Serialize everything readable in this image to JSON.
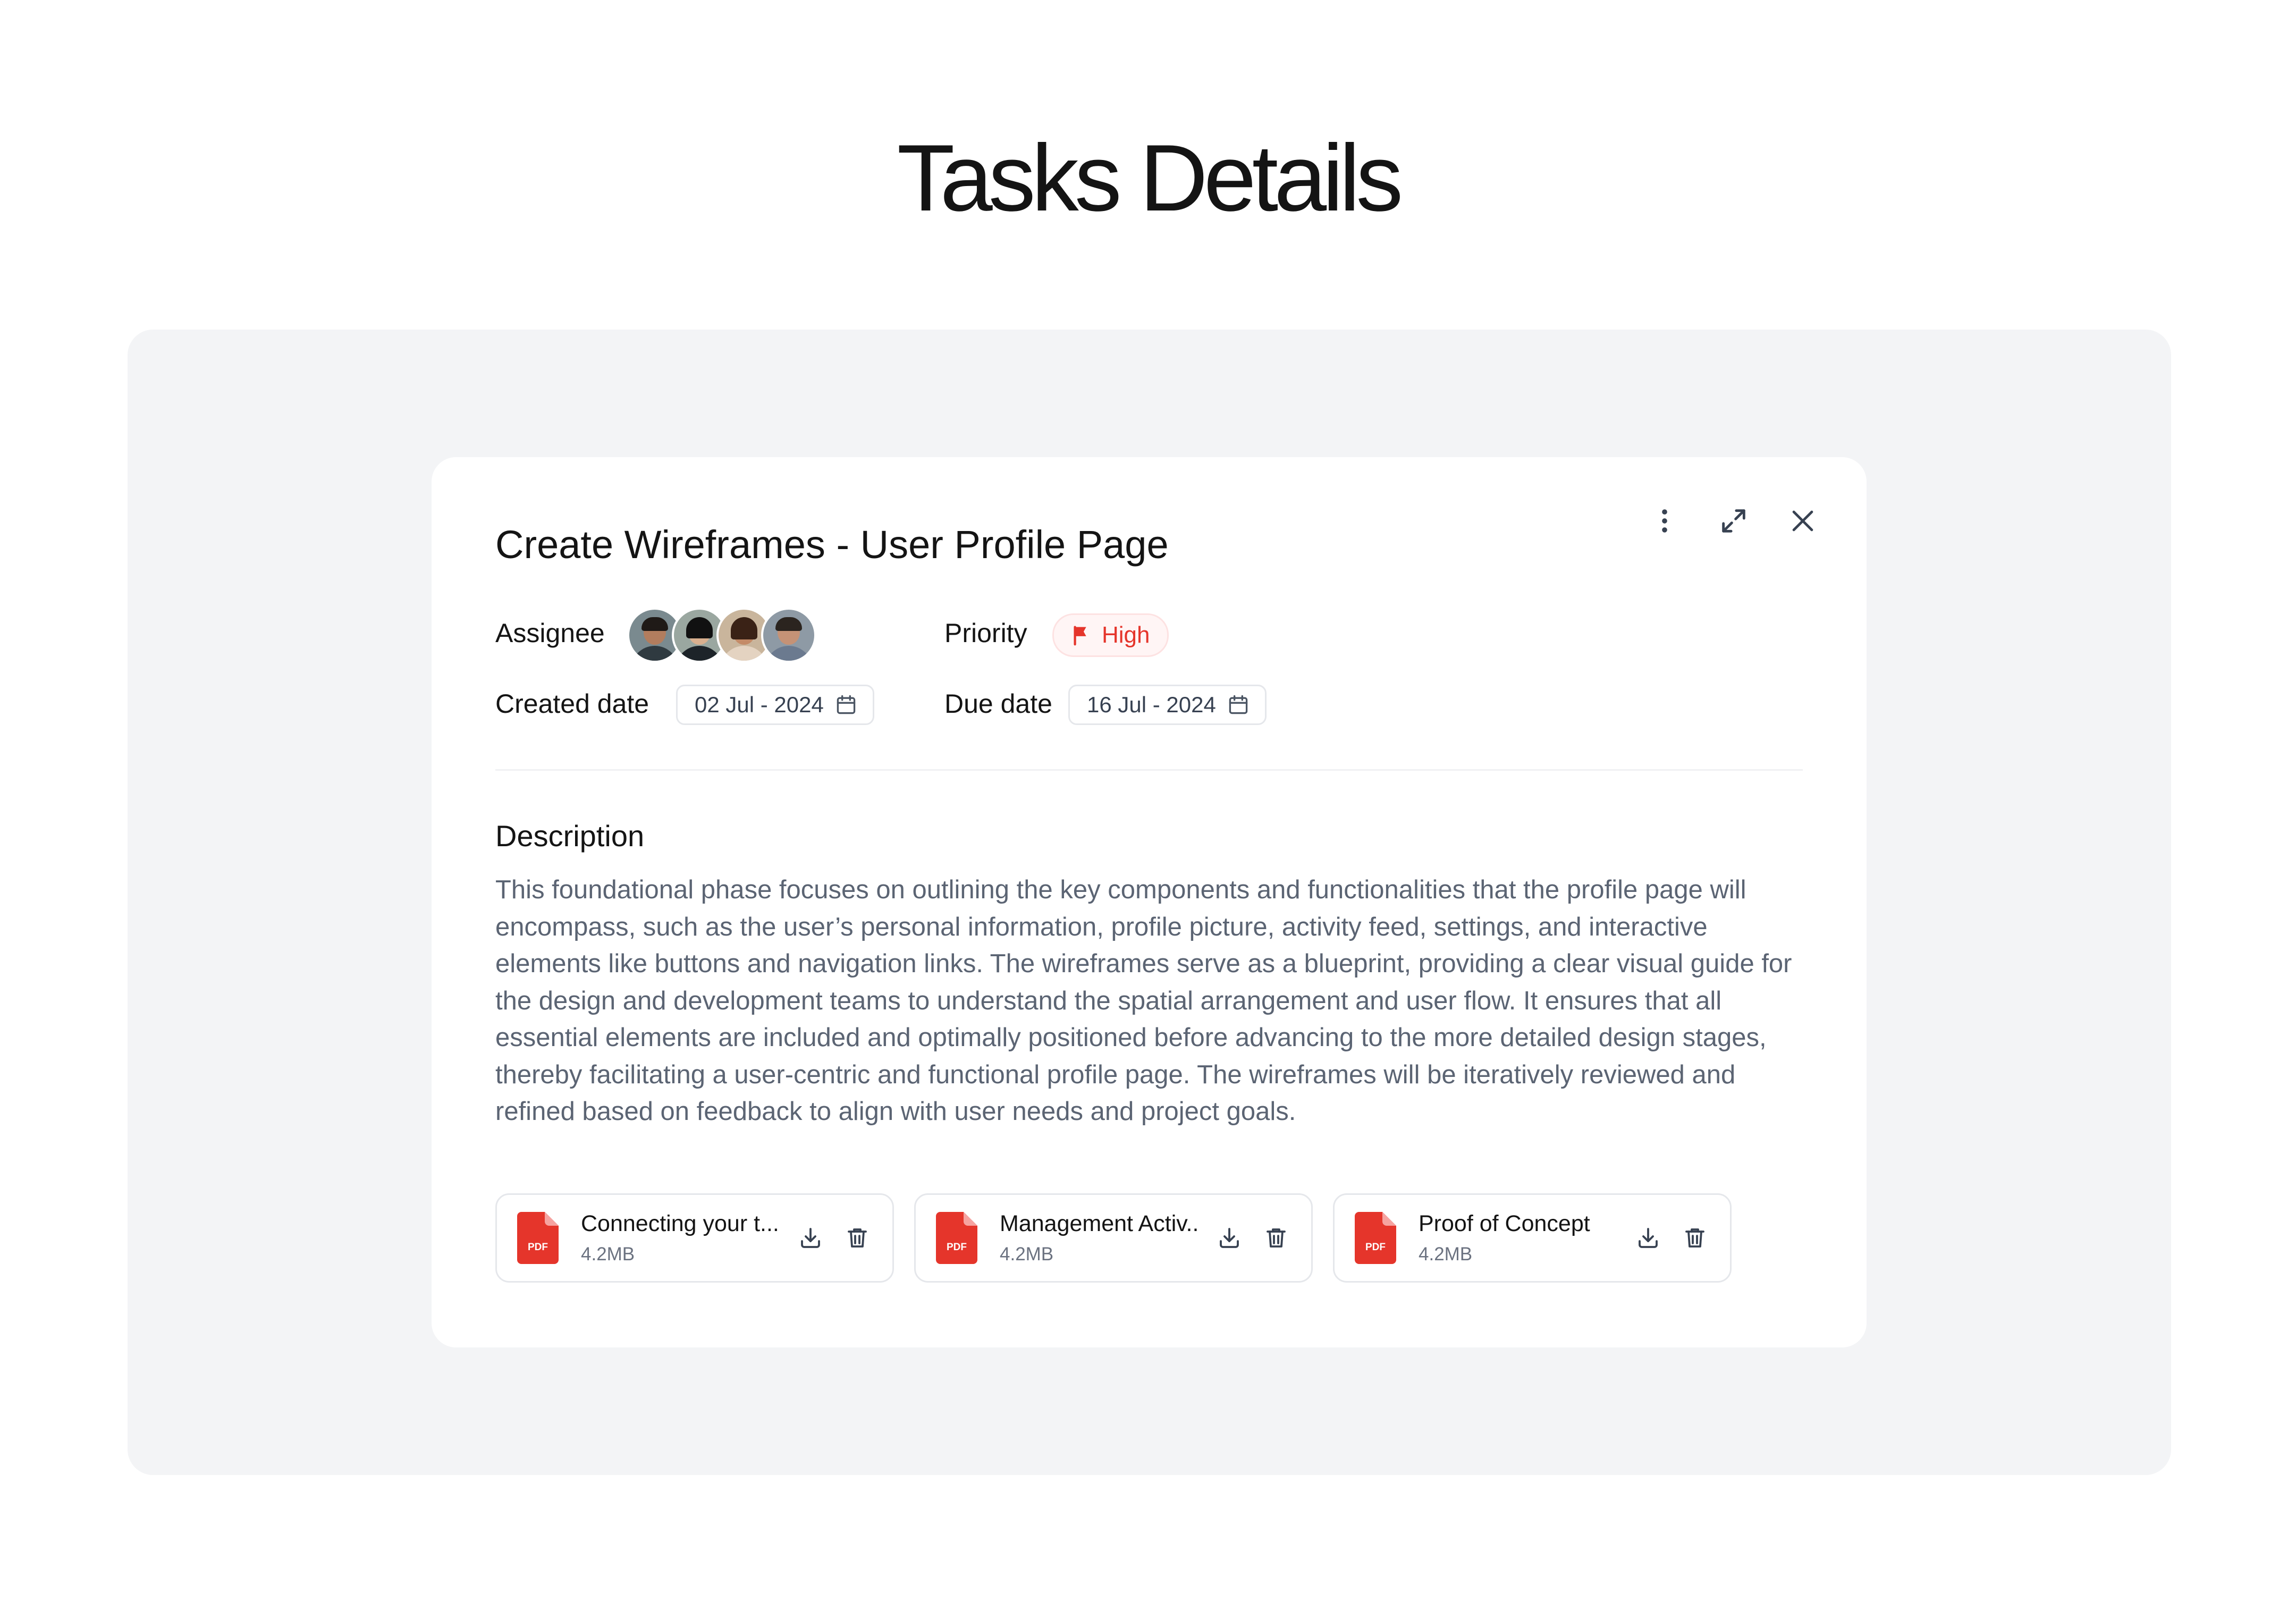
{
  "page": {
    "title": "Tasks Details"
  },
  "task": {
    "title": "Create Wireframes - User Profile Page",
    "assignee_label": "Assignee",
    "assignees": [
      {
        "name": "avatar-1"
      },
      {
        "name": "avatar-2"
      },
      {
        "name": "avatar-3"
      },
      {
        "name": "avatar-4"
      }
    ],
    "priority_label": "Priority",
    "priority_value": "High",
    "created_label": "Created date",
    "created_value": "02 Jul - 2024",
    "due_label": "Due date",
    "due_value": "16 Jul - 2024",
    "description_title": "Description",
    "description_lines": [
      "This foundational phase focuses on outlining the key components and functionalities that the profile page will",
      "encompass, such as the user’s personal information, profile picture, activity feed, settings, and interactive",
      "elements like buttons and navigation links. The wireframes serve as a blueprint, providing a clear visual guide for",
      "the design and development teams to understand the spatial arrangement and user flow. It ensures that all",
      "essential elements are included and optimally positioned before advancing to the more detailed design stages,",
      "thereby facilitating a user-centric and functional profile page. The wireframes will be iteratively reviewed and",
      "refined based on feedback to align with user needs and project goals."
    ]
  },
  "attachments": [
    {
      "name": "Connecting your t...",
      "size": "4.2MB",
      "type": "PDF"
    },
    {
      "name": "Management Activ...",
      "size": "4.2MB",
      "type": "PDF"
    },
    {
      "name": "Proof of Concept",
      "size": "4.2MB",
      "type": "PDF"
    }
  ],
  "icons": {
    "more": "more-vertical-icon",
    "expand": "expand-icon",
    "close": "close-icon",
    "flag": "flag-icon",
    "calendar": "calendar-icon",
    "pdf": "pdf-file-icon",
    "download": "download-icon",
    "delete": "trash-icon"
  },
  "colors": {
    "stage_background": "#f3f4f6",
    "priority_high": "#e5352b",
    "pdf_red": "#e5352b",
    "text_primary": "#141414",
    "text_secondary": "#5b6473"
  }
}
